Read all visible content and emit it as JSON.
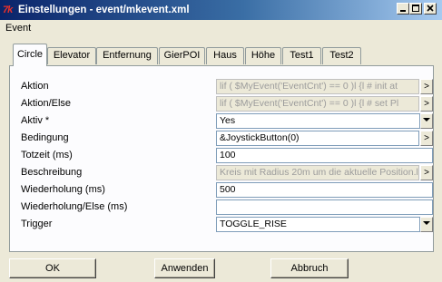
{
  "window": {
    "app_icon_text": "7k",
    "title": "Einstellungen - event/mkevent.xml"
  },
  "menubar": {
    "items": [
      "Event"
    ]
  },
  "tabs": [
    "Circle",
    "Elevator",
    "Entfernung",
    "GierPOI",
    "Haus",
    "Höhe",
    "Test1",
    "Test2"
  ],
  "active_tab": "Circle",
  "properties": [
    {
      "label": "Aktion",
      "value": "lif ( $MyEvent('EventCnt') == 0 )l    {l    # init at",
      "disabled": true,
      "button": ">"
    },
    {
      "label": "Aktion/Else",
      "value": "lif ( $MyEvent('EventCnt') == 0 )l    {l    # set Pl",
      "disabled": true,
      "button": ">"
    },
    {
      "label": "Aktiv *",
      "value": "Yes",
      "disabled": false,
      "button": "dropdown"
    },
    {
      "label": "Bedingung",
      "value": "&JoystickButton(0)",
      "disabled": false,
      "button": ">"
    },
    {
      "label": "Totzeit (ms)",
      "value": "100",
      "disabled": false,
      "button": ""
    },
    {
      "label": "Beschreibung",
      "value": "Kreis mit Radius 20m um die aktuelle Position.l",
      "disabled": true,
      "button": ">"
    },
    {
      "label": "Wiederholung (ms)",
      "value": "500",
      "disabled": false,
      "button": ""
    },
    {
      "label": "Wiederholung/Else (ms)",
      "value": "",
      "disabled": false,
      "button": ""
    },
    {
      "label": "Trigger",
      "value": "TOGGLE_RISE",
      "disabled": false,
      "button": "dropdown"
    }
  ],
  "buttons": {
    "ok": "OK",
    "apply": "Anwenden",
    "cancel": "Abbruch"
  }
}
